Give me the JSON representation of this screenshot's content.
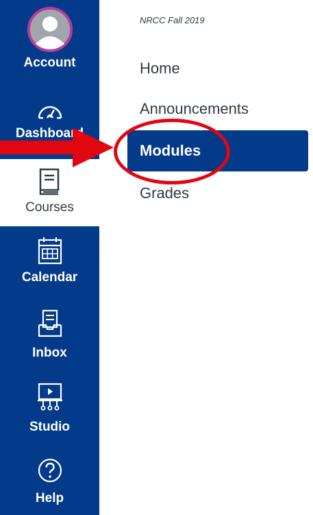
{
  "global_nav": {
    "items": [
      {
        "label": "Account",
        "icon": "avatar-icon"
      },
      {
        "label": "Dashboard",
        "icon": "speedometer-icon"
      },
      {
        "label": "Courses",
        "icon": "book-icon",
        "active": true
      },
      {
        "label": "Calendar",
        "icon": "calendar-icon"
      },
      {
        "label": "Inbox",
        "icon": "inbox-icon"
      },
      {
        "label": "Studio",
        "icon": "studio-icon"
      },
      {
        "label": "Help",
        "icon": "help-icon"
      }
    ]
  },
  "course_nav": {
    "course_title": "NRCC Fall 2019",
    "links": [
      {
        "label": "Home"
      },
      {
        "label": "Announcements"
      },
      {
        "label": "Modules",
        "active": true
      },
      {
        "label": "Grades"
      }
    ]
  },
  "annotation": {
    "color": "#e10610"
  },
  "colors": {
    "nav_background": "#033a8a",
    "active_link_background": "#033a8a",
    "text": "#2d3b45"
  }
}
